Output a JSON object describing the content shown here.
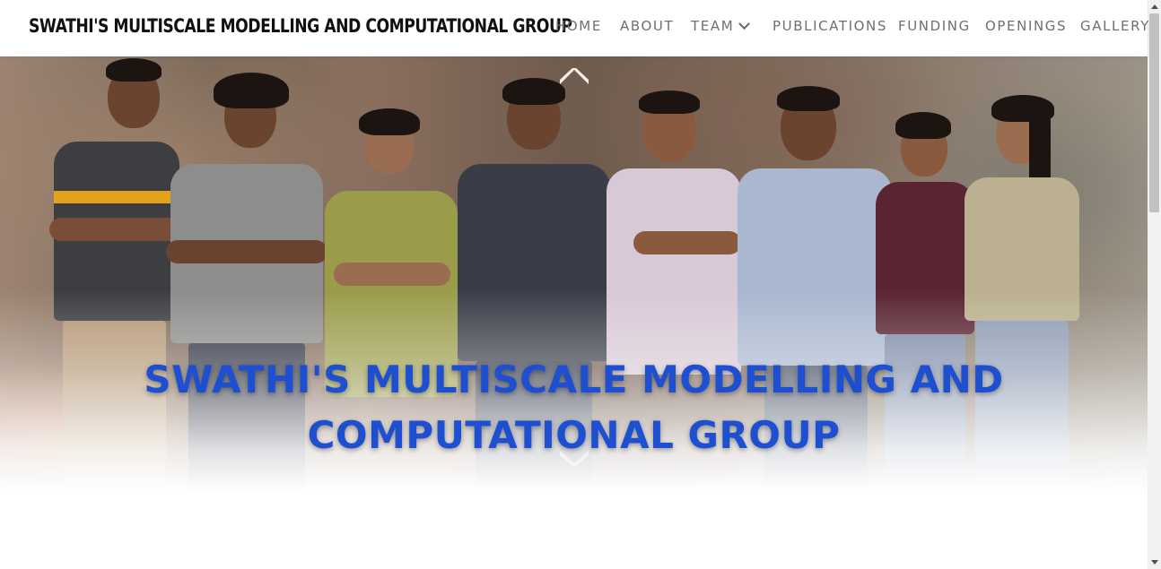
{
  "header": {
    "site_title": "SWATHI'S MULTISCALE MODELLING AND COMPUTATIONAL GROUP",
    "nav": [
      {
        "label": "HOME"
      },
      {
        "label": "ABOUT"
      },
      {
        "label": "TEAM",
        "has_dropdown": true
      },
      {
        "label": "PUBLICATIONS"
      },
      {
        "label": "FUNDING"
      },
      {
        "label": "OPENINGS"
      },
      {
        "label": "GALLERY"
      }
    ]
  },
  "hero": {
    "title_line1": "SWATHI'S MULTISCALE MODELLING AND",
    "title_line2": "COMPUTATIONAL GROUP",
    "image_subject": "group photo",
    "prev_icon": "chevron-up-icon",
    "next_icon": "chevron-down-icon"
  },
  "colors": {
    "title_blue": "#1d4fd0",
    "nav_text": "#6f6f6f",
    "site_title": "#111111"
  }
}
